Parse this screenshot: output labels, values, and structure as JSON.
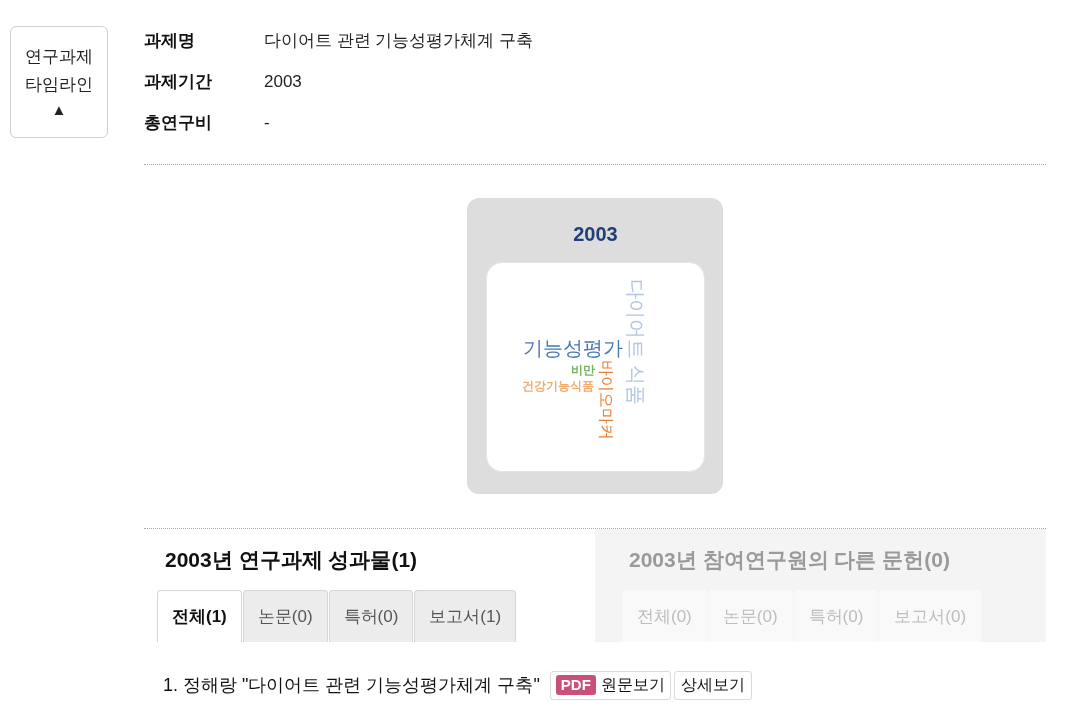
{
  "timeline_toggle": {
    "label": "연구과제 타임라인",
    "arrow": "▲"
  },
  "project": [
    {
      "label": "과제명",
      "value": "다이어트 관련 기능성평가체계 구축"
    },
    {
      "label": "과제기간",
      "value": "2003"
    },
    {
      "label": "총연구비",
      "value": "-"
    }
  ],
  "word_cloud": {
    "year": "2003",
    "words": [
      {
        "text": "기능성평가",
        "kind": "large",
        "vertical": false,
        "color": "#4a78b4"
      },
      {
        "text": "다이어트 식품",
        "kind": "large",
        "vertical": true,
        "color": "#b3c6e3"
      },
      {
        "text": "바이오마커",
        "kind": "medium",
        "vertical": true,
        "color": "#e8823a"
      },
      {
        "text": "비만",
        "kind": "small",
        "vertical": false,
        "color": "#74b35f"
      },
      {
        "text": "건강기능식품",
        "kind": "small",
        "vertical": false,
        "color": "#f0ad6e"
      }
    ]
  },
  "sections": [
    {
      "title": "2003년 연구과제 성과물(1)",
      "selected": true,
      "tabs": [
        {
          "label": "전체(1)",
          "selected": true
        },
        {
          "label": "논문(0)",
          "selected": false
        },
        {
          "label": "특허(0)",
          "selected": false
        },
        {
          "label": "보고서(1)",
          "selected": false
        }
      ]
    },
    {
      "title": "2003년 참여연구원의 다른 문헌(0)",
      "selected": false,
      "tabs": [
        {
          "label": "전체(0)",
          "selected": false
        },
        {
          "label": "논문(0)",
          "selected": false
        },
        {
          "label": "특허(0)",
          "selected": false
        },
        {
          "label": "보고서(0)",
          "selected": false
        }
      ]
    }
  ],
  "results": [
    {
      "citation": "1. 정해랑 \"다이어트 관련 기능성평가체계 구축\"",
      "pdf_badge": "PDF",
      "original_button": "원문보기",
      "detail_button": "상세보기"
    }
  ]
}
